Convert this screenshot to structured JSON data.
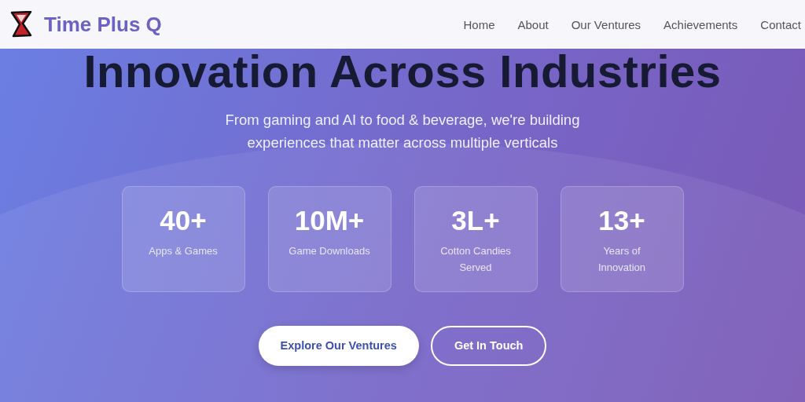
{
  "brand": {
    "name": "Time Plus Q"
  },
  "nav": [
    {
      "label": "Home"
    },
    {
      "label": "About"
    },
    {
      "label": "Our Ventures"
    },
    {
      "label": "Achievements"
    },
    {
      "label": "Contact"
    }
  ],
  "hero": {
    "title": "Innovation Across Industries",
    "subtitle": "From gaming and AI to food & beverage, we're building experiences that matter across multiple verticals"
  },
  "stats": [
    {
      "value": "40+",
      "label": "Apps & Games"
    },
    {
      "value": "10M+",
      "label": "Game Downloads"
    },
    {
      "value": "3L+",
      "label": "Cotton Candies Served"
    },
    {
      "value": "13+",
      "label": "Years of Innovation"
    }
  ],
  "buttons": [
    {
      "label": "Explore Our Ventures",
      "kind": "primary"
    },
    {
      "label": "Get In Touch",
      "kind": "outline"
    }
  ]
}
